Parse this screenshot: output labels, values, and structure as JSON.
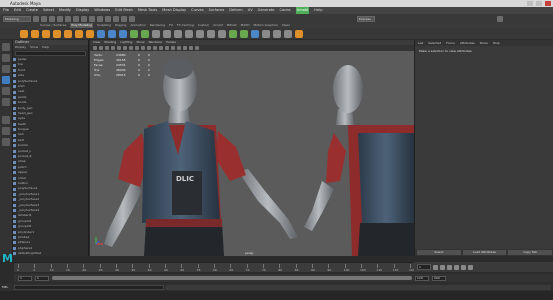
{
  "window": {
    "title": "Autodesk Maya"
  },
  "menubar": {
    "items": [
      "File",
      "Edit",
      "Create",
      "Select",
      "Modify",
      "Display",
      "Windows",
      "Edit Mesh",
      "Mesh Tools",
      "Mesh Display",
      "Curves",
      "Surfaces",
      "Deform",
      "UV",
      "Generate",
      "Cache",
      "Arnold",
      "Help"
    ],
    "highlighted": "Arnold"
  },
  "statusline": {
    "menuset": "Modeling",
    "search_placeholder": "",
    "camera": "Express"
  },
  "shelf": {
    "tabs": [
      "Curves / Surfaces",
      "Poly Modeling",
      "Sculpting",
      "Rigging",
      "Animation",
      "Rendering",
      "FX",
      "FX Caching",
      "Custom",
      "Arnold",
      "Bifrost",
      "MASH",
      "Motion Graphics",
      "XGen"
    ],
    "active": "Poly Modeling"
  },
  "outliner": {
    "title": "Outliner",
    "menu": [
      "Display",
      "Show",
      "Help"
    ],
    "rows": [
      {
        "label": "persp",
        "sel": false
      },
      {
        "label": "top",
        "sel": false
      },
      {
        "label": "front",
        "sel": false
      },
      {
        "label": "side",
        "sel": false
      },
      {
        "label": "polySurface1",
        "sel": false
      },
      {
        "label": "shirt",
        "sel": false
      },
      {
        "label": "vest",
        "sel": false
      },
      {
        "label": "pants",
        "sel": false
      },
      {
        "label": "boots",
        "sel": false
      },
      {
        "label": "body_geo",
        "sel": false
      },
      {
        "label": "head_geo",
        "sel": false
      },
      {
        "label": "eyes",
        "sel": false
      },
      {
        "label": "teeth",
        "sel": false
      },
      {
        "label": "tongue",
        "sel": false
      },
      {
        "label": "hair",
        "sel": false
      },
      {
        "label": "belt",
        "sel": false
      },
      {
        "label": "buckle",
        "sel": false
      },
      {
        "label": "pocket_L",
        "sel": false
      },
      {
        "label": "pocket_R",
        "sel": false
      },
      {
        "label": "strap",
        "sel": false
      },
      {
        "label": "patch",
        "sel": false
      },
      {
        "label": "zipper",
        "sel": false
      },
      {
        "label": "collar",
        "sel": false
      },
      {
        "label": "button",
        "sel": false
      },
      {
        "label": "polySurface1",
        "sel": false
      },
      {
        "label": "_polySurface1",
        "sel": false
      },
      {
        "label": "_polySurface2",
        "sel": false
      },
      {
        "label": "_polySurface3",
        "sel": false
      },
      {
        "label": "_polySurface4",
        "sel": false
      },
      {
        "label": "lambert1",
        "sel": false
      },
      {
        "label": "groupId1",
        "sel": false
      },
      {
        "label": "groupId2",
        "sel": false
      },
      {
        "label": "pCylinder1",
        "sel": false
      },
      {
        "label": "pCube1",
        "sel": false
      },
      {
        "label": "pPlane1",
        "sel": false
      },
      {
        "label": "pSphere1",
        "sel": false
      },
      {
        "label": "defaultLightSet",
        "sel": false
      },
      {
        "label": "defaultObjectSet",
        "sel": false
      }
    ]
  },
  "viewport": {
    "menu": [
      "View",
      "Shading",
      "Lighting",
      "Show",
      "Renderer",
      "Panels"
    ],
    "hud": [
      [
        "Verts:",
        "24680",
        "0",
        "0"
      ],
      [
        "Edges:",
        "49155",
        "0",
        "0"
      ],
      [
        "Faces:",
        "24531",
        "0",
        "0"
      ],
      [
        "Tris:",
        "48934",
        "0",
        "0"
      ],
      [
        "UVs:",
        "28015",
        "0",
        "0"
      ]
    ],
    "camera_label": "persp"
  },
  "attribute_editor": {
    "menu": [
      "List",
      "Selected",
      "Focus",
      "Attributes",
      "Show",
      "Help"
    ],
    "message": "Make a selection to view attributes.",
    "buttons": [
      "Select",
      "Load Attributes",
      "Copy Tab"
    ]
  },
  "time": {
    "ticks": [
      "1",
      "5",
      "10",
      "15",
      "20",
      "25",
      "30",
      "35",
      "40",
      "45",
      "50",
      "55",
      "60",
      "65",
      "70",
      "75",
      "80",
      "85",
      "90",
      "95",
      "100",
      "105",
      "110",
      "115",
      "120"
    ],
    "current_frame": "1"
  },
  "range": {
    "start": "1",
    "start_inner": "1",
    "end_inner": "120",
    "end": "200"
  },
  "cmd": {
    "label": "MEL"
  },
  "help": {
    "text": ""
  }
}
